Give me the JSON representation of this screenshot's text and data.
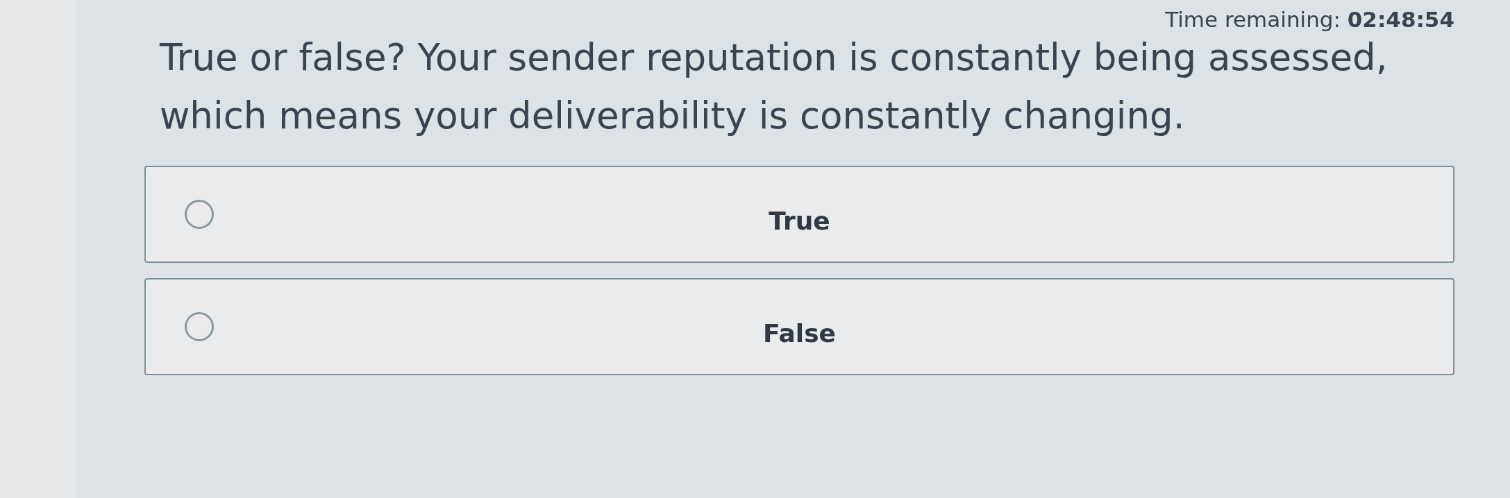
{
  "timer": "Time remaining: **02:48:54**",
  "question": "True or false? Your sender reputation is constantly being assessed, which means your deliverability is constantly changing.",
  "options": [
    {
      "label": "True",
      "selected": false
    },
    {
      "label": "False",
      "selected": false
    }
  ]
}
